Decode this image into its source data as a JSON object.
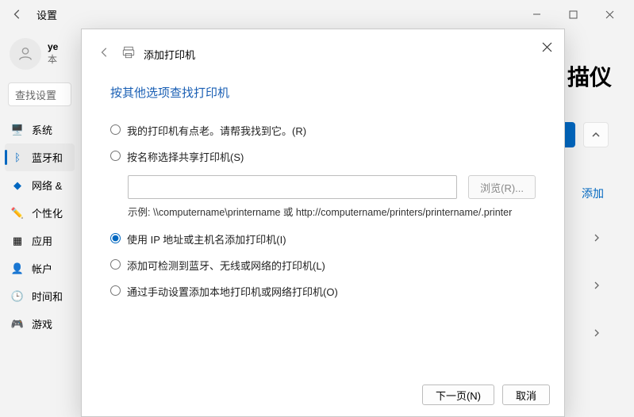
{
  "window": {
    "title": "设置"
  },
  "profile": {
    "name": "ye",
    "sub": "本"
  },
  "search": {
    "placeholder": "查找设置"
  },
  "nav": [
    {
      "icon": "🖥️",
      "label": "系统",
      "active": false
    },
    {
      "icon": "ᛒ",
      "label": "蓝牙和",
      "active": true,
      "iconColor": "#0067c0"
    },
    {
      "icon": "◆",
      "label": "网络 &",
      "active": false,
      "iconColor": "#0067c0"
    },
    {
      "icon": "✏️",
      "label": "个性化",
      "active": false
    },
    {
      "icon": "▦",
      "label": "应用",
      "active": false
    },
    {
      "icon": "👤",
      "label": "帐户",
      "active": false
    },
    {
      "icon": "🕒",
      "label": "时间和",
      "active": false
    },
    {
      "icon": "🎮",
      "label": "游戏",
      "active": false
    }
  ],
  "content": {
    "cutTitle": "描仪",
    "addLink": "添加"
  },
  "dialog": {
    "title": "添加打印机",
    "subtitle": "按其他选项查找打印机",
    "options": {
      "oldPrinter": "我的打印机有点老。请帮我找到它。(R)",
      "byName": "按名称选择共享打印机(S)",
      "browse": "浏览(R)...",
      "hint": "示例: \\\\computername\\printername 或 http://computername/printers/printername/.printer",
      "byIp": "使用 IP 地址或主机名添加打印机(I)",
      "detectable": "添加可检测到蓝牙、无线或网络的打印机(L)",
      "manual": "通过手动设置添加本地打印机或网络打印机(O)"
    },
    "buttons": {
      "next": "下一页(N)",
      "cancel": "取消"
    }
  }
}
